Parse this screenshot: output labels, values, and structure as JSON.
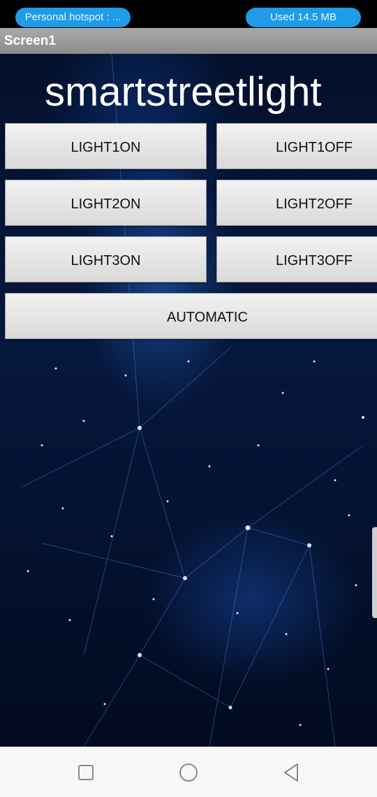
{
  "status_bar": {
    "hotspot_label": "Personal hotspot : ...",
    "data_usage_label": "Used  14.5 MB"
  },
  "title_bar": {
    "title": "Screen1"
  },
  "main": {
    "heading": "smartstreetlight",
    "buttons": {
      "light1_on": "LIGHT1ON",
      "light1_off": "LIGHT1OFF",
      "light2_on": "LIGHT2ON",
      "light2_off": "LIGHT2OFF",
      "light3_on": "LIGHT3ON",
      "light3_off": "LIGHT3OFF",
      "automatic": "AUTOMATIC"
    }
  },
  "nav_bar": {
    "icons": [
      "recent-apps-icon",
      "home-icon",
      "back-icon"
    ]
  },
  "colors": {
    "status_pill": "#1e9be9",
    "title_bar": "#9a9a9a",
    "background": "#06183e",
    "button": "#e6e6e6"
  }
}
